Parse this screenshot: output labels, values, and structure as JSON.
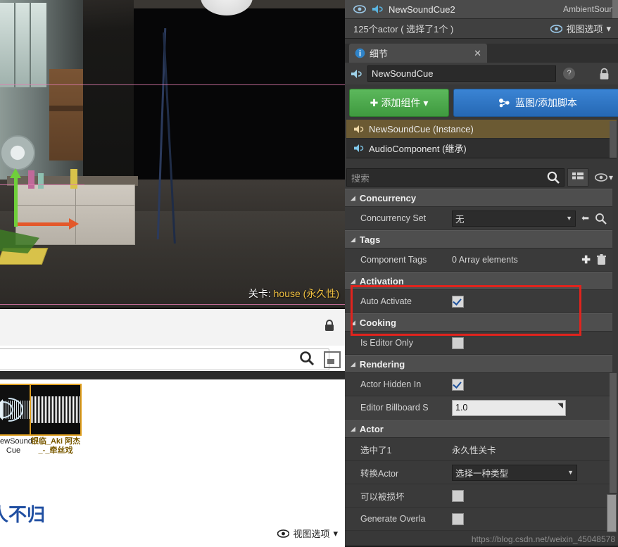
{
  "viewport": {
    "level_label_prefix": "关卡:",
    "level_name": "house (永久性)"
  },
  "content_browser": {
    "search_placeholder": "",
    "assets": [
      {
        "name": "NewSound Cue",
        "kind": "sound-cue"
      },
      {
        "name": "银临_Aki 阿杰_-_牵丝戏",
        "kind": "sound-wave"
      }
    ],
    "overlay_text": "人不归",
    "view_options_label": "视图选项"
  },
  "world_outliner": {
    "row": {
      "name": "NewSoundCue2",
      "type": "AmbientSoun"
    },
    "status": "125个actor ( 选择了1个 )",
    "view_options_label": "视图选项"
  },
  "details_panel": {
    "tab_label": "细节",
    "tab_close": "✕",
    "name_value": "NewSoundCue",
    "help_glyph": "?",
    "add_component_label": "添加组件",
    "blueprint_label": "蓝图/添加脚本",
    "components": [
      {
        "label": "NewSoundCue (Instance)",
        "selected": true
      },
      {
        "label": "AudioComponent (继承)",
        "selected": false
      }
    ],
    "search_placeholder": "搜索",
    "categories": [
      {
        "name": "Concurrency",
        "rows": [
          {
            "label": "Concurrency Set",
            "control": "combo",
            "value": "无"
          }
        ]
      },
      {
        "name": "Tags",
        "rows": [
          {
            "label": "Component Tags",
            "control": "array",
            "value": "0 Array elements"
          }
        ]
      },
      {
        "name": "Activation",
        "rows": [
          {
            "label": "Auto Activate",
            "control": "checkbox",
            "value": "checked"
          }
        ]
      },
      {
        "name": "Cooking",
        "rows": [
          {
            "label": "Is Editor Only",
            "control": "checkbox",
            "value": "unchecked"
          }
        ]
      },
      {
        "name": "Rendering",
        "rows": [
          {
            "label": "Actor Hidden In ",
            "control": "checkbox",
            "value": "checked"
          },
          {
            "label": "Editor Billboard S",
            "control": "number",
            "value": "1.0"
          }
        ]
      },
      {
        "name": "Actor",
        "rows": [
          {
            "label": "选中了1",
            "control": "text",
            "value": "永久性关卡"
          },
          {
            "label": "转换Actor",
            "control": "combo",
            "value": "选择一种类型"
          },
          {
            "label": "可以被损坏",
            "control": "checkbox",
            "value": "unchecked"
          },
          {
            "label": "Generate Overla",
            "control": "checkbox",
            "value": "unchecked"
          }
        ]
      }
    ]
  },
  "watermark": "https://blog.csdn.net/weixin_45048578",
  "colors": {
    "green_button": "#4faa4f",
    "blue_button": "#2f77c4",
    "highlight_row": "#6b5a33",
    "red_box": "#e1231d",
    "level_name": "#f0c040"
  }
}
